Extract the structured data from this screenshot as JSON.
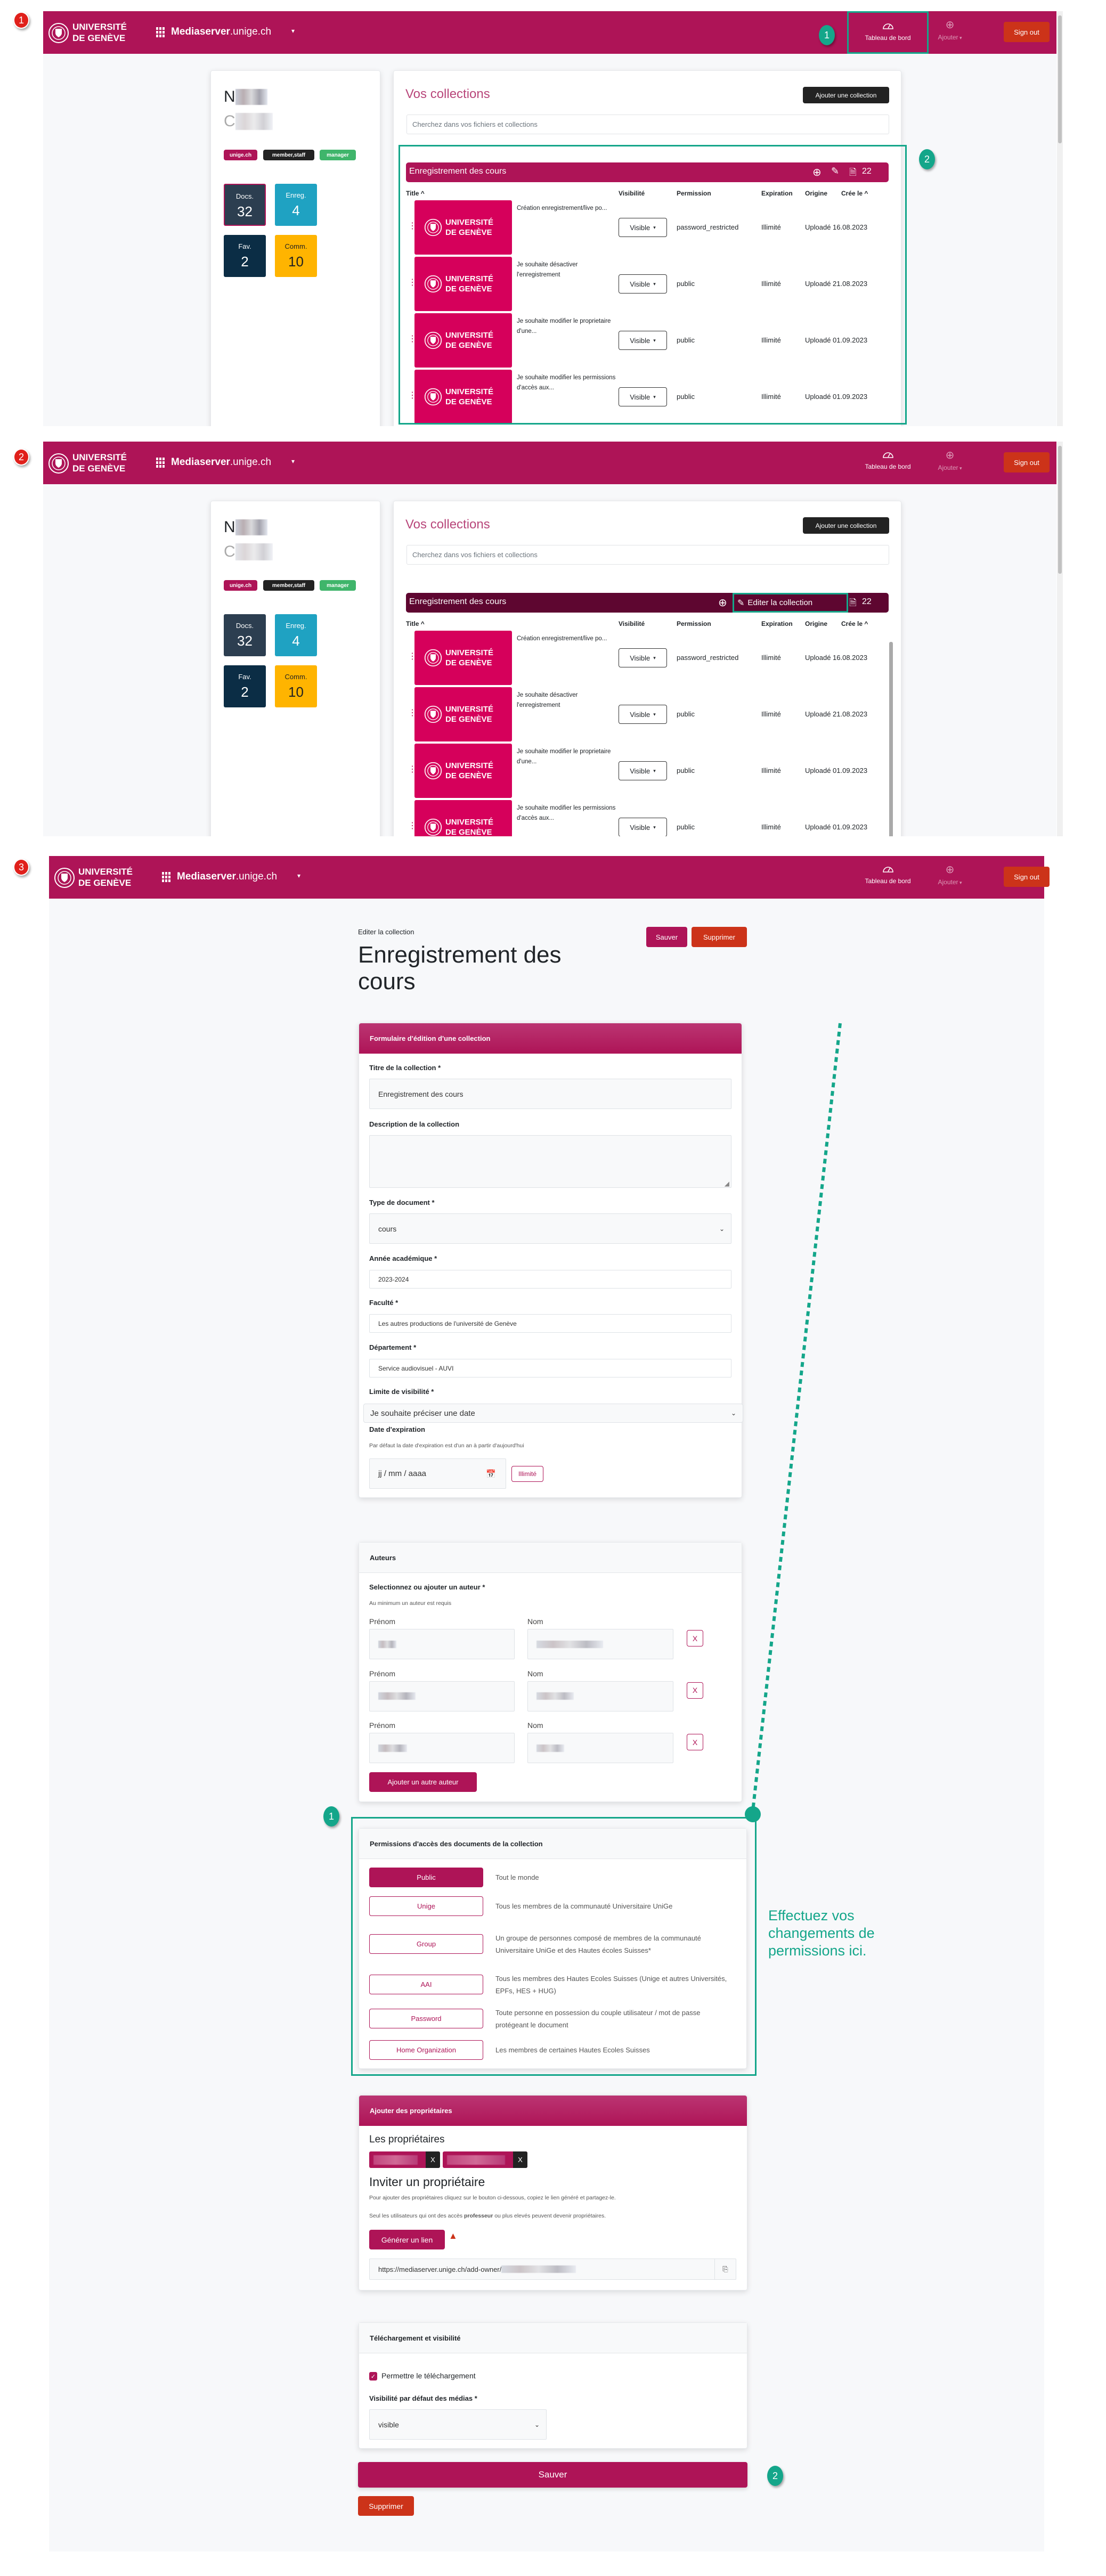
{
  "app": {
    "logo_line1": "UNIVERSITÉ",
    "logo_line2": "DE GENÈVE",
    "site_bold": "Mediaserver",
    "site_rest": ".unige.ch",
    "nav_dashboard": "Tableau de bord",
    "nav_add": "Ajouter",
    "sign_out": "Sign out"
  },
  "step_badges": [
    "1",
    "2",
    "3"
  ],
  "callouts": {
    "p1_dashboard": "1",
    "p1_collection": "2",
    "p3_permissions": "1",
    "p3_save": "2",
    "p3_note": "Effectuez vos changements de permissions ici."
  },
  "colors": {
    "brand": "#ae1457",
    "danger": "#cc3319",
    "callout": "#14a68a",
    "dark_bar": "#5e0630",
    "thumb": "#d6005b"
  },
  "profile": {
    "name_initial": "N",
    "second_initial": "C",
    "tags": [
      {
        "label": "unige.ch",
        "color": "#ae1457"
      },
      {
        "label": "member,staff",
        "color": "#222222"
      },
      {
        "label": "manager",
        "color": "#3fb56b"
      }
    ],
    "stats": [
      {
        "label": "Docs.",
        "value": "32",
        "color": "#2c3e50",
        "text": "#ffffff"
      },
      {
        "label": "Enreg.",
        "value": "4",
        "color": "#1fa2c2",
        "text": "#ffffff"
      },
      {
        "label": "Fav.",
        "value": "2",
        "color": "#0b2d45",
        "text": "#ffffff"
      },
      {
        "label": "Comm.",
        "value": "10",
        "color": "#ffb400",
        "text": "#222222"
      }
    ]
  },
  "collections": {
    "title": "Vos collections",
    "add_button": "Ajouter une collection",
    "search_placeholder": "Cherchez dans vos fichiers et collections",
    "collection_name": "Enregistrement des cours",
    "doc_count": "22",
    "edit_tooltip": "Editer la collection",
    "columns": [
      "Title ^",
      "Visibilité",
      "Permission",
      "Expiration",
      "Origine",
      "Crée le ^"
    ],
    "thumb_logo": "UNIVERSITÉ DE GENÈVE",
    "rows": [
      {
        "title": "Création enregistrement/live po...",
        "visibility": "Visible",
        "permission": "password_restricted",
        "expiration": "Illimité",
        "origin": "Uploadé 16.08.2023"
      },
      {
        "title": "Je souhaite désactiver l'enregistrement",
        "visibility": "Visible",
        "permission": "public",
        "expiration": "Illimité",
        "origin": "Uploadé 21.08.2023"
      },
      {
        "title": "Je souhaite modifier le proprietaire d'une...",
        "visibility": "Visible",
        "permission": "public",
        "expiration": "Illimité",
        "origin": "Uploadé 01.09.2023"
      },
      {
        "title": "Je souhaite modifier les permissions d'accès aux...",
        "visibility": "Visible",
        "permission": "public",
        "expiration": "Illimité",
        "origin": "Uploadé 01.09.2023"
      }
    ]
  },
  "edit": {
    "breadcrumb": "Editer la collection",
    "title": "Enregistrement des cours",
    "save": "Sauver",
    "delete": "Supprimer",
    "form": {
      "header": "Formulaire d'édition d'une collection",
      "title_label": "Titre de la collection *",
      "title_value": "Enregistrement des cours",
      "desc_label": "Description de la collection",
      "type_label": "Type de document *",
      "type_value": "cours",
      "year_label": "Année académique *",
      "year_value": "2023-2024",
      "faculty_label": "Faculté *",
      "faculty_value": "Les autres productions de l'université de Genève",
      "dept_label": "Département *",
      "dept_value": "Service audiovisuel - AUVI",
      "limit_label": "Limite de visibilité *",
      "limit_value": "Je souhaite préciser une date",
      "exp_label": "Date d'expiration",
      "exp_help": "Par défaut la date d'expiration est d'un an à partir d'aujourd'hui",
      "exp_placeholder": "jj / mm / aaaa",
      "unlimited": "Illimité"
    },
    "authors": {
      "header": "Auteurs",
      "label": "Selectionnez ou ajouter un auteur *",
      "help": "Au minimum un auteur est requis",
      "first_label": "Prénom",
      "last_label": "Nom",
      "remove": "X",
      "add": "Ajouter un autre auteur"
    },
    "permissions": {
      "header": "Permissions d'accès des documents de la collection",
      "selected": "Public",
      "options": [
        {
          "label": "Public",
          "desc": "Tout le monde"
        },
        {
          "label": "Unige",
          "desc": "Tous les membres de la communauté Universitaire UniGe"
        },
        {
          "label": "Group",
          "desc": "Un groupe de personnes composé de membres de la communauté Universitaire UniGe et des Hautes écoles Suisses*"
        },
        {
          "label": "AAI",
          "desc": "Tous les membres des Hautes Ecoles Suisses (Unige et autres Universités, EPFs, HES + HUG)"
        },
        {
          "label": "Password",
          "desc": "Toute personne en possession du couple utilisateur / mot de passe protégeant le document"
        },
        {
          "label": "Home Organization",
          "desc": "Les membres de certaines Hautes Ecoles Suisses"
        }
      ]
    },
    "owners": {
      "header": "Ajouter des propriétaires",
      "owners_title": "Les propriétaires",
      "remove": "X",
      "invite_title": "Inviter un propriétaire",
      "help1": "Pour ajouter des propriétaires cliquez sur le bouton ci-dessous, copiez le lien généré et partagez-le.",
      "help2_pre": "Seul les utilisateurs qui ont des accès ",
      "help2_bold": "professeur",
      "help2_post": " ou plus elevés peuvent devenir propriétaires.",
      "generate": "Générer un lien",
      "link_prefix": "https://mediaserver.unige.ch/add-owner/"
    },
    "download": {
      "header": "Téléchargement et visibilité",
      "allow_label": "Permettre le téléchargement",
      "allow_checked": true,
      "vis_label": "Visibilité par défaut des médias *",
      "vis_value": "visible"
    }
  }
}
